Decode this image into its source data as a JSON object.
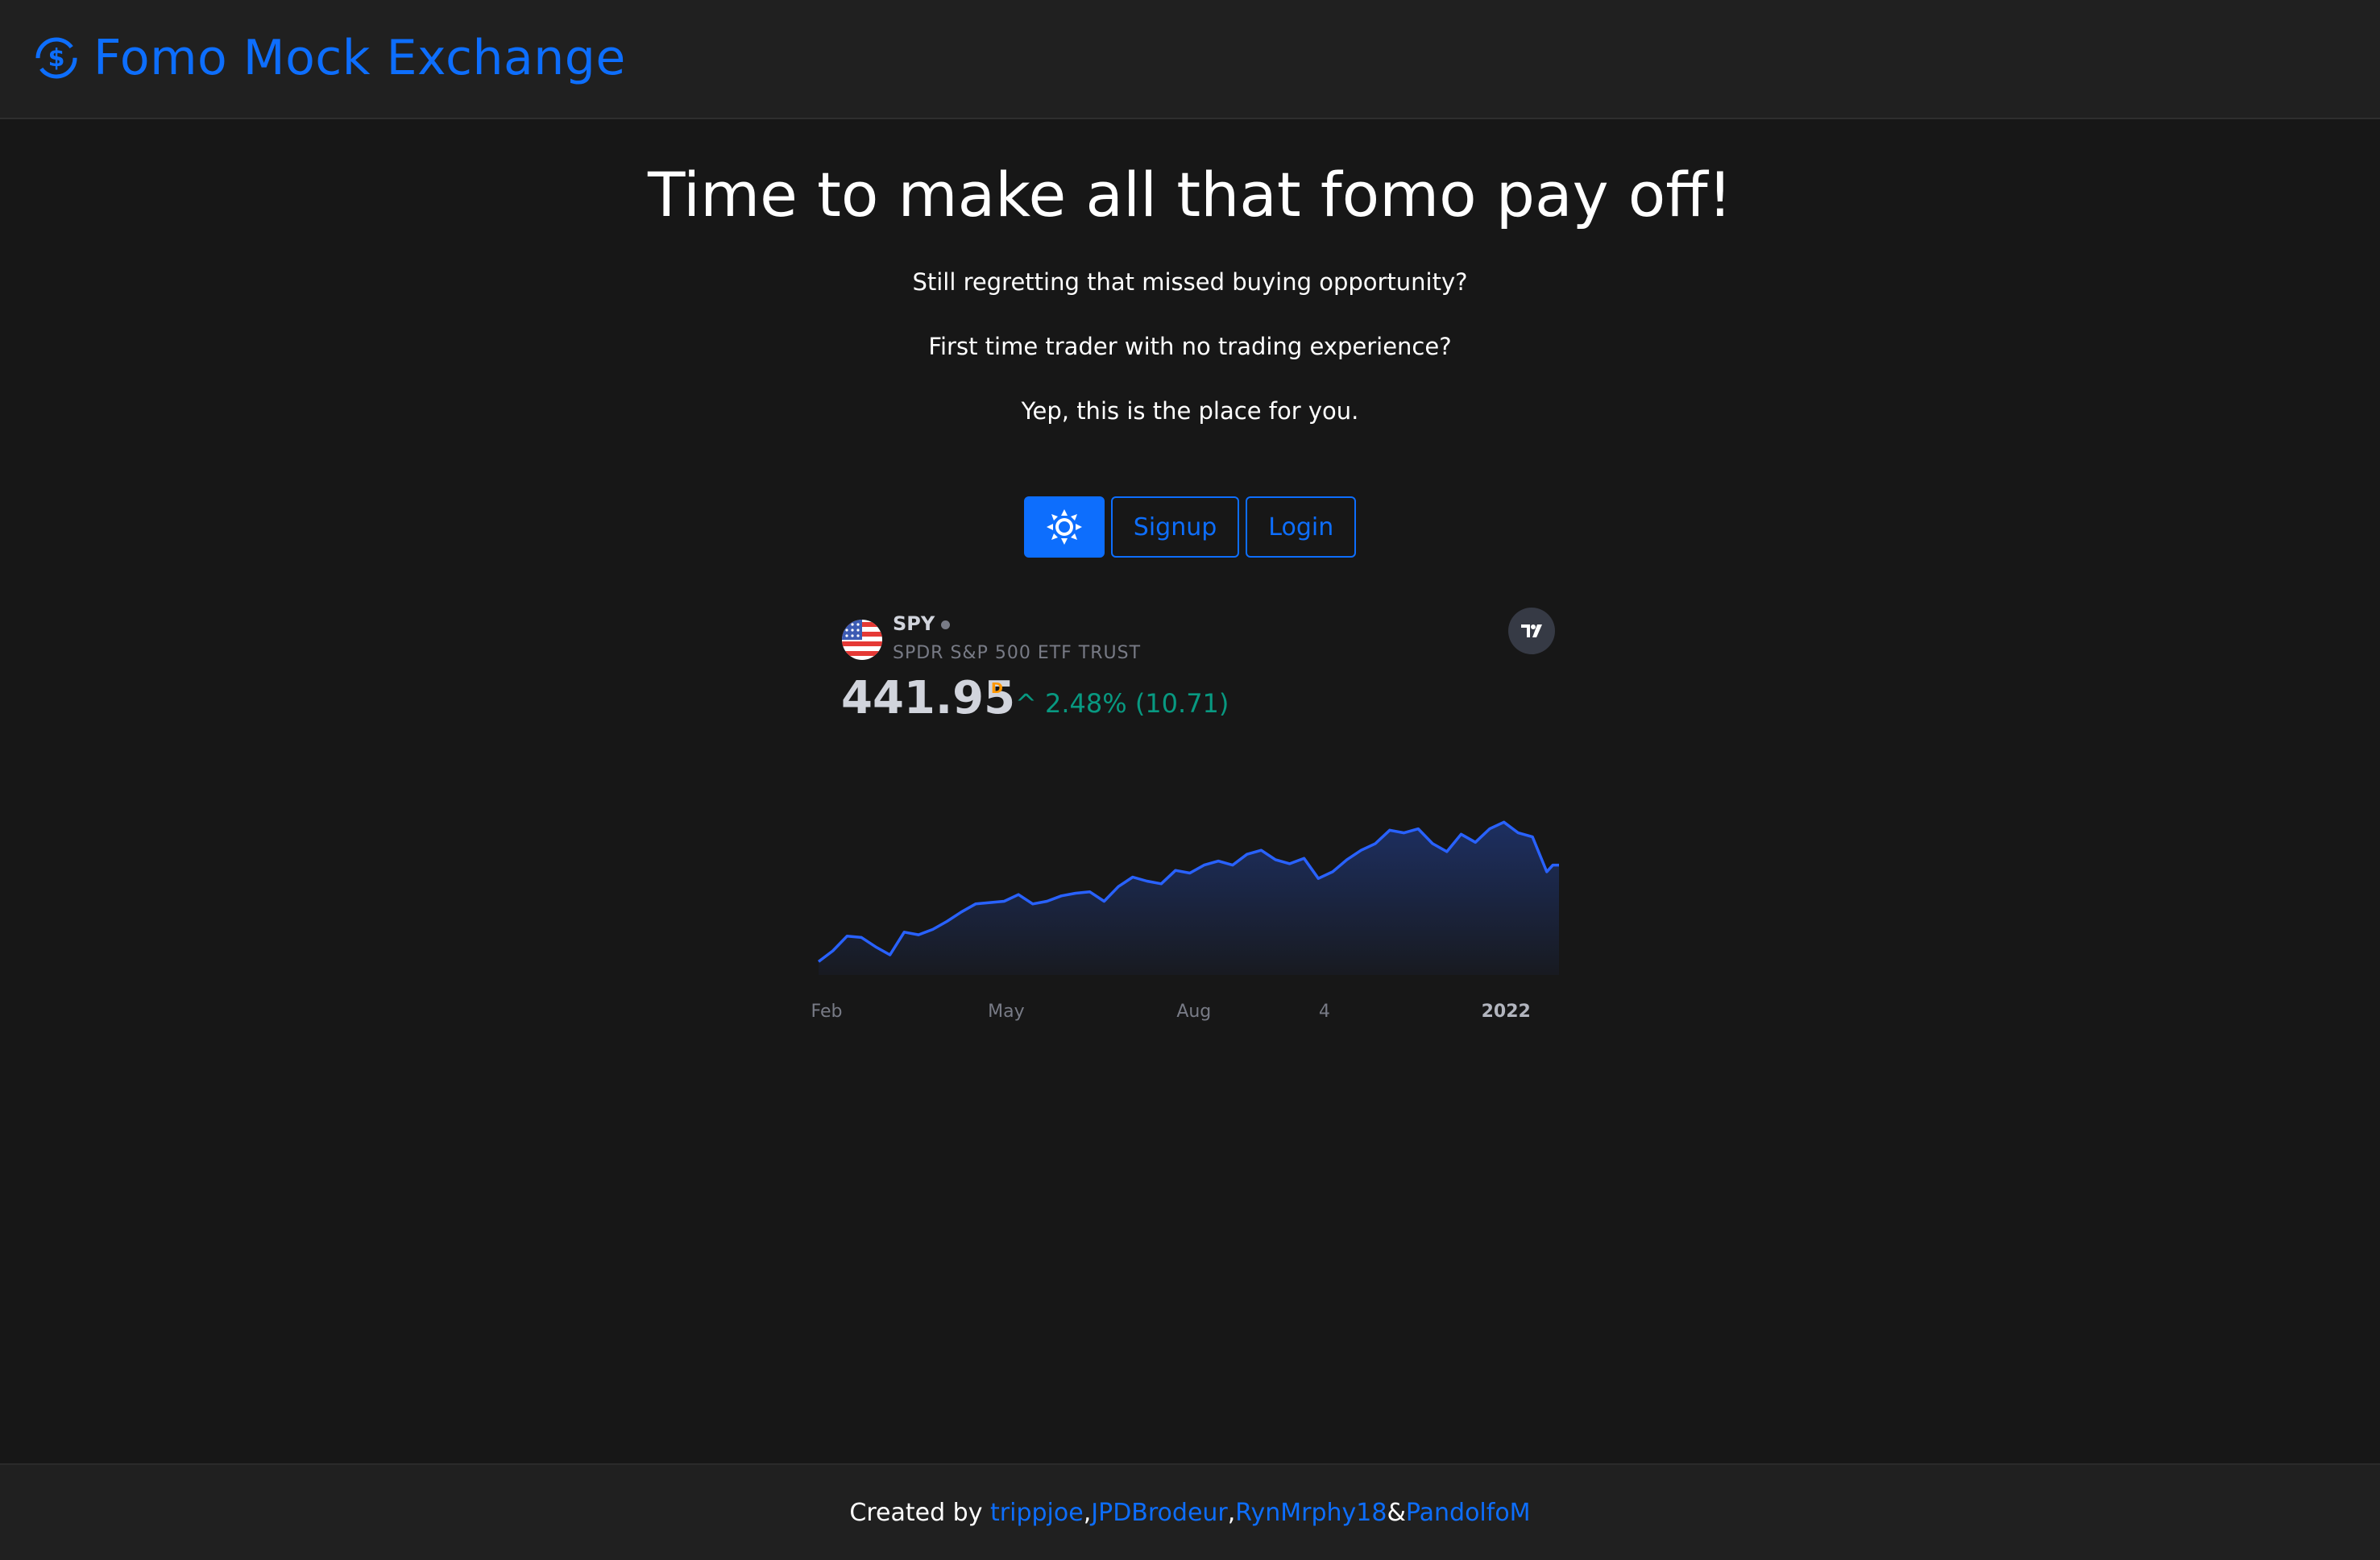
{
  "nav": {
    "brand": "Fomo Mock Exchange",
    "brand_icon": "dollar-cycle-icon"
  },
  "hero": {
    "title": "Time to make all that fomo pay off!",
    "line1": "Still regretting that missed buying opportunity?",
    "line2": "First time trader with no trading experience?",
    "line3": "Yep, this is the place for you."
  },
  "buttons": {
    "theme_icon": "sun-icon",
    "signup": "Signup",
    "login": "Login"
  },
  "widget": {
    "symbol": "SPY",
    "name": "SPDR S&P 500 ETF TRUST",
    "price": "441.95",
    "price_flag": "D",
    "change_arrow": "^",
    "change": "2.48% (10.71)",
    "flag_icon": "us-flag-icon",
    "logo_icon": "tradingview-logo-icon"
  },
  "chart_data": {
    "type": "area",
    "x_ticks": [
      "Feb",
      "May",
      "Aug",
      "4",
      "2022"
    ],
    "x_tick_dates": [
      "2021-02-01",
      "2021-05-01",
      "2021-08-01",
      "2021-10-04",
      "2022-01-01"
    ],
    "series": [
      {
        "x": [
          "2021-01-29",
          "2021-02-05",
          "2021-02-12",
          "2021-02-19",
          "2021-02-26",
          "2021-03-05",
          "2021-03-12",
          "2021-03-19",
          "2021-03-26",
          "2021-04-02",
          "2021-04-09",
          "2021-04-16",
          "2021-04-23",
          "2021-04-30",
          "2021-05-07",
          "2021-05-14",
          "2021-05-21",
          "2021-05-28",
          "2021-06-04",
          "2021-06-11",
          "2021-06-18",
          "2021-06-25",
          "2021-07-02",
          "2021-07-09",
          "2021-07-16",
          "2021-07-23",
          "2021-07-30",
          "2021-08-06",
          "2021-08-13",
          "2021-08-20",
          "2021-08-27",
          "2021-09-03",
          "2021-09-10",
          "2021-09-17",
          "2021-09-24",
          "2021-10-01",
          "2021-10-08",
          "2021-10-15",
          "2021-10-22",
          "2021-10-29",
          "2021-11-05",
          "2021-11-12",
          "2021-11-19",
          "2021-11-26",
          "2021-12-03",
          "2021-12-10",
          "2021-12-17",
          "2021-12-24",
          "2021-12-31",
          "2022-01-07",
          "2022-01-14",
          "2022-01-21",
          "2022-01-24",
          "2022-01-27"
        ],
        "values": [
          370,
          378,
          389,
          388,
          381,
          375,
          392,
          390,
          394,
          400,
          407,
          413,
          414,
          415,
          420,
          413,
          415,
          419,
          421,
          422,
          415,
          426,
          433,
          430,
          428,
          438,
          436,
          442,
          445,
          442,
          450,
          453,
          446,
          443,
          447,
          432,
          437,
          446,
          453,
          458,
          468,
          466,
          469,
          458,
          452,
          465,
          459,
          469,
          474,
          466,
          463,
          437,
          442,
          441.95
        ]
      }
    ],
    "ylim": [
      360,
      485
    ]
  },
  "footer": {
    "prefix": "Created by ",
    "authors": [
      "trippjoe",
      "JPDBrodeur",
      "RynMrphy18",
      "PandolfoM"
    ],
    "sep1": ", ",
    "sep2": ", ",
    "sep3": " & "
  },
  "colors": {
    "accent": "#0d6efd",
    "line": "#2962ff",
    "positive": "#089981",
    "flag": "#ff9800"
  }
}
